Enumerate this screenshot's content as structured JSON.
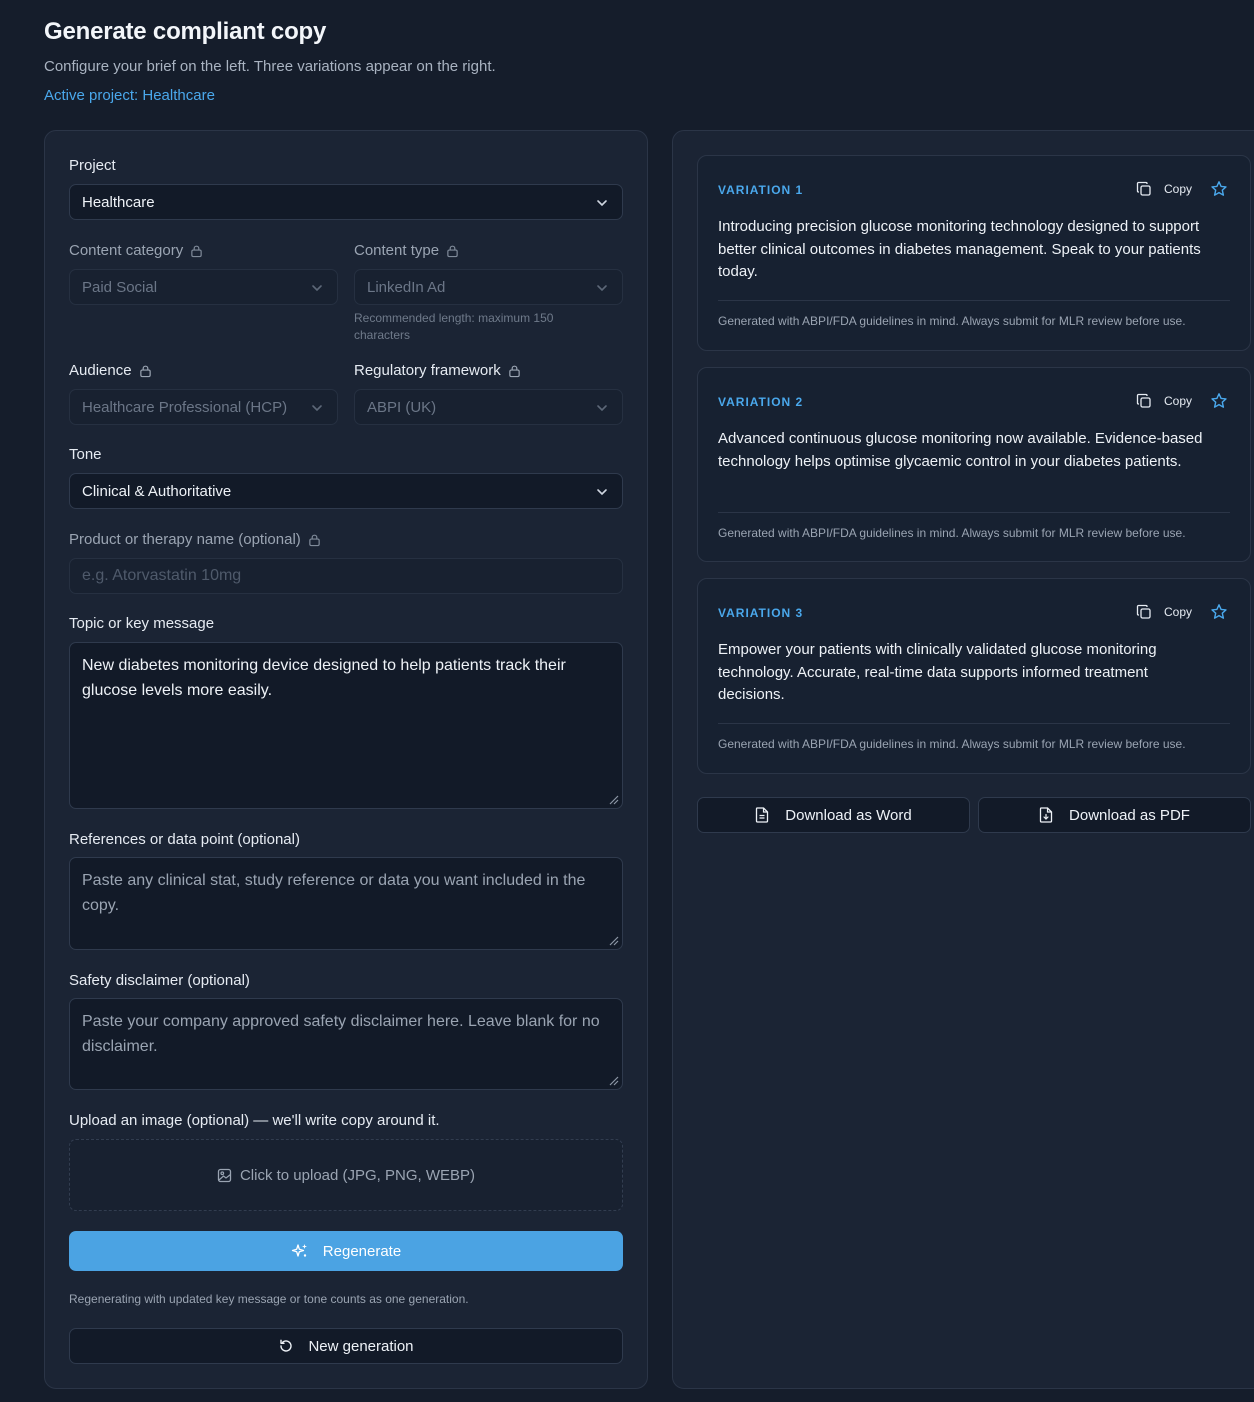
{
  "header": {
    "title": "Generate compliant copy",
    "subtitle": "Configure your brief on the left. Three variations appear on the right.",
    "active_project": "Active project: Healthcare"
  },
  "form": {
    "project": {
      "label": "Project",
      "value": "Healthcare"
    },
    "content_category": {
      "label": "Content category",
      "value": "Paid Social"
    },
    "content_type": {
      "label": "Content type",
      "value": "LinkedIn Ad",
      "helper": "Recommended length: maximum 150 characters"
    },
    "audience": {
      "label": "Audience",
      "value": "Healthcare Professional (HCP)"
    },
    "regulatory_framework": {
      "label": "Regulatory framework",
      "value": "ABPI (UK)"
    },
    "tone": {
      "label": "Tone",
      "value": "Clinical & Authoritative"
    },
    "product_name": {
      "label": "Product or therapy name (optional)",
      "placeholder": "e.g. Atorvastatin 10mg"
    },
    "topic": {
      "label": "Topic or key message",
      "value": "New diabetes monitoring device designed to help patients track their glucose levels more easily."
    },
    "references": {
      "label": "References or data point (optional)",
      "placeholder": "Paste any clinical stat, study reference or data you want included in the copy."
    },
    "disclaimer": {
      "label": "Safety disclaimer (optional)",
      "placeholder": "Paste your company approved safety disclaimer here. Leave blank for no disclaimer."
    },
    "upload": {
      "label": "Upload an image (optional) — we'll write copy around it.",
      "button": "Click to upload (JPG, PNG, WEBP)"
    },
    "regenerate_button": "Regenerate",
    "regenerate_note": "Regenerating with updated key message or tone counts as one generation.",
    "new_generation_button": "New generation"
  },
  "variations": [
    {
      "title": "VARIATION 1",
      "copy_label": "Copy",
      "text": "Introducing precision glucose monitoring technology designed to support better clinical outcomes in diabetes management. Speak to your patients today.",
      "footer": "Generated with ABPI/FDA guidelines in mind. Always submit for MLR review before use."
    },
    {
      "title": "VARIATION 2",
      "copy_label": "Copy",
      "text": "Advanced continuous glucose monitoring now available. Evidence-based technology helps optimise glycaemic control in your diabetes patients.",
      "footer": "Generated with ABPI/FDA guidelines in mind. Always submit for MLR review before use."
    },
    {
      "title": "VARIATION 3",
      "copy_label": "Copy",
      "text": "Empower your patients with clinically validated glucose monitoring technology. Accurate, real-time data supports informed treatment decisions.",
      "footer": "Generated with ABPI/FDA guidelines in mind. Always submit for MLR review before use."
    }
  ],
  "downloads": {
    "word": "Download as Word",
    "pdf": "Download as PDF"
  },
  "colors": {
    "background": "#151d2b",
    "panel": "#1b2434",
    "accent": "#4ba3e3",
    "link": "#4aa8ec"
  }
}
